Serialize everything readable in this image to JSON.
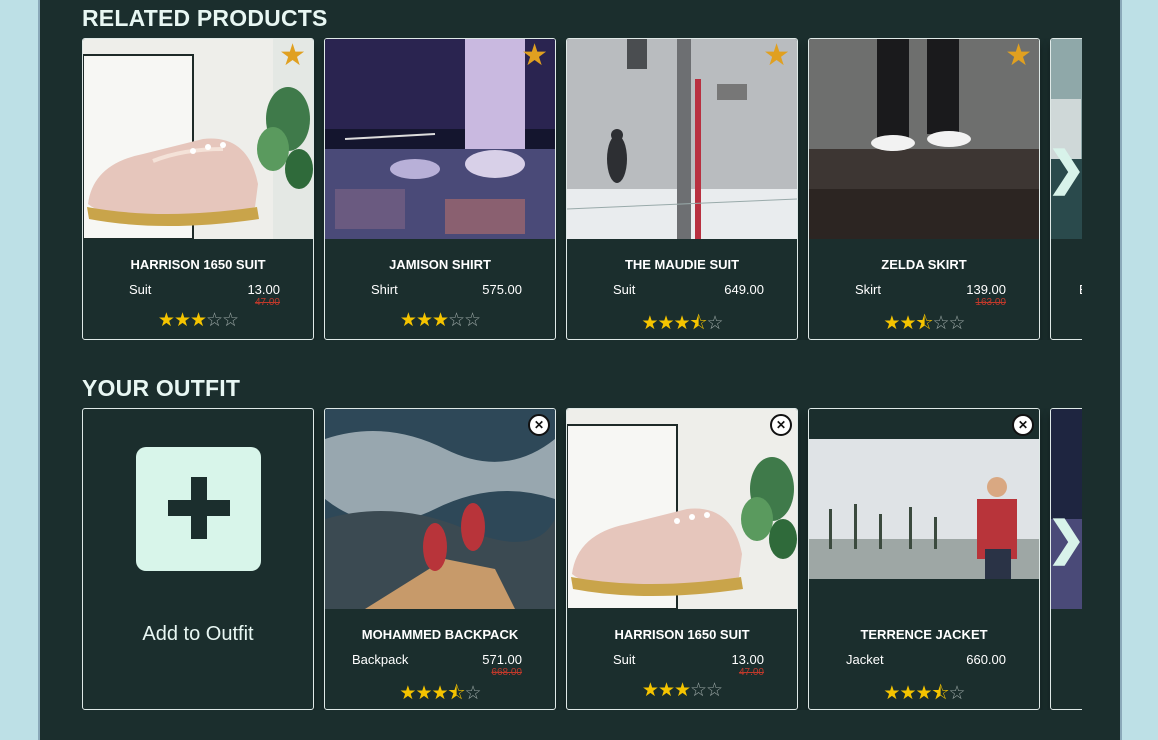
{
  "related": {
    "title": "RELATED PRODUCTS",
    "products": [
      {
        "name": "HARRISON 1650 SUIT",
        "category": "Suit",
        "price": "13.00",
        "old_price": "47.00",
        "rating": 3,
        "image": "pink-oxford-shoes"
      },
      {
        "name": "JAMISON SHIRT",
        "category": "Shirt",
        "price": "575.00",
        "old_price": "",
        "rating": 3,
        "image": "concert-stage-sneakers"
      },
      {
        "name": "THE MAUDIE SUIT",
        "category": "Suit",
        "price": "649.00",
        "old_price": "",
        "rating": 3.5,
        "image": "snowy-street"
      },
      {
        "name": "ZELDA SKIRT",
        "category": "Skirt",
        "price": "139.00",
        "old_price": "163.00",
        "rating": 2.5,
        "image": "white-sneakers-ground"
      }
    ],
    "next_label": "❯"
  },
  "outfit": {
    "title": "YOUR OUTFIT",
    "add_label": "Add to Outfit",
    "items": [
      {
        "name": "MOHAMMED BACKPACK",
        "category": "Backpack",
        "price": "571.00",
        "old_price": "668.00",
        "rating": 3.5,
        "image": "feet-over-sea"
      },
      {
        "name": "HARRISON 1650 SUIT",
        "category": "Suit",
        "price": "13.00",
        "old_price": "47.00",
        "rating": 3,
        "image": "pink-oxford-shoes"
      },
      {
        "name": "TERRENCE JACKET",
        "category": "Jacket",
        "price": "660.00",
        "old_price": "",
        "rating": 3.5,
        "image": "man-plaid-shirt-beach"
      }
    ],
    "next_label": "❯"
  },
  "colors": {
    "background": "#1b2e2d",
    "page": "#bde0e6",
    "star_filled": "#f5c400",
    "favorite": "#e0a020",
    "sale_price": "#c0392b"
  }
}
